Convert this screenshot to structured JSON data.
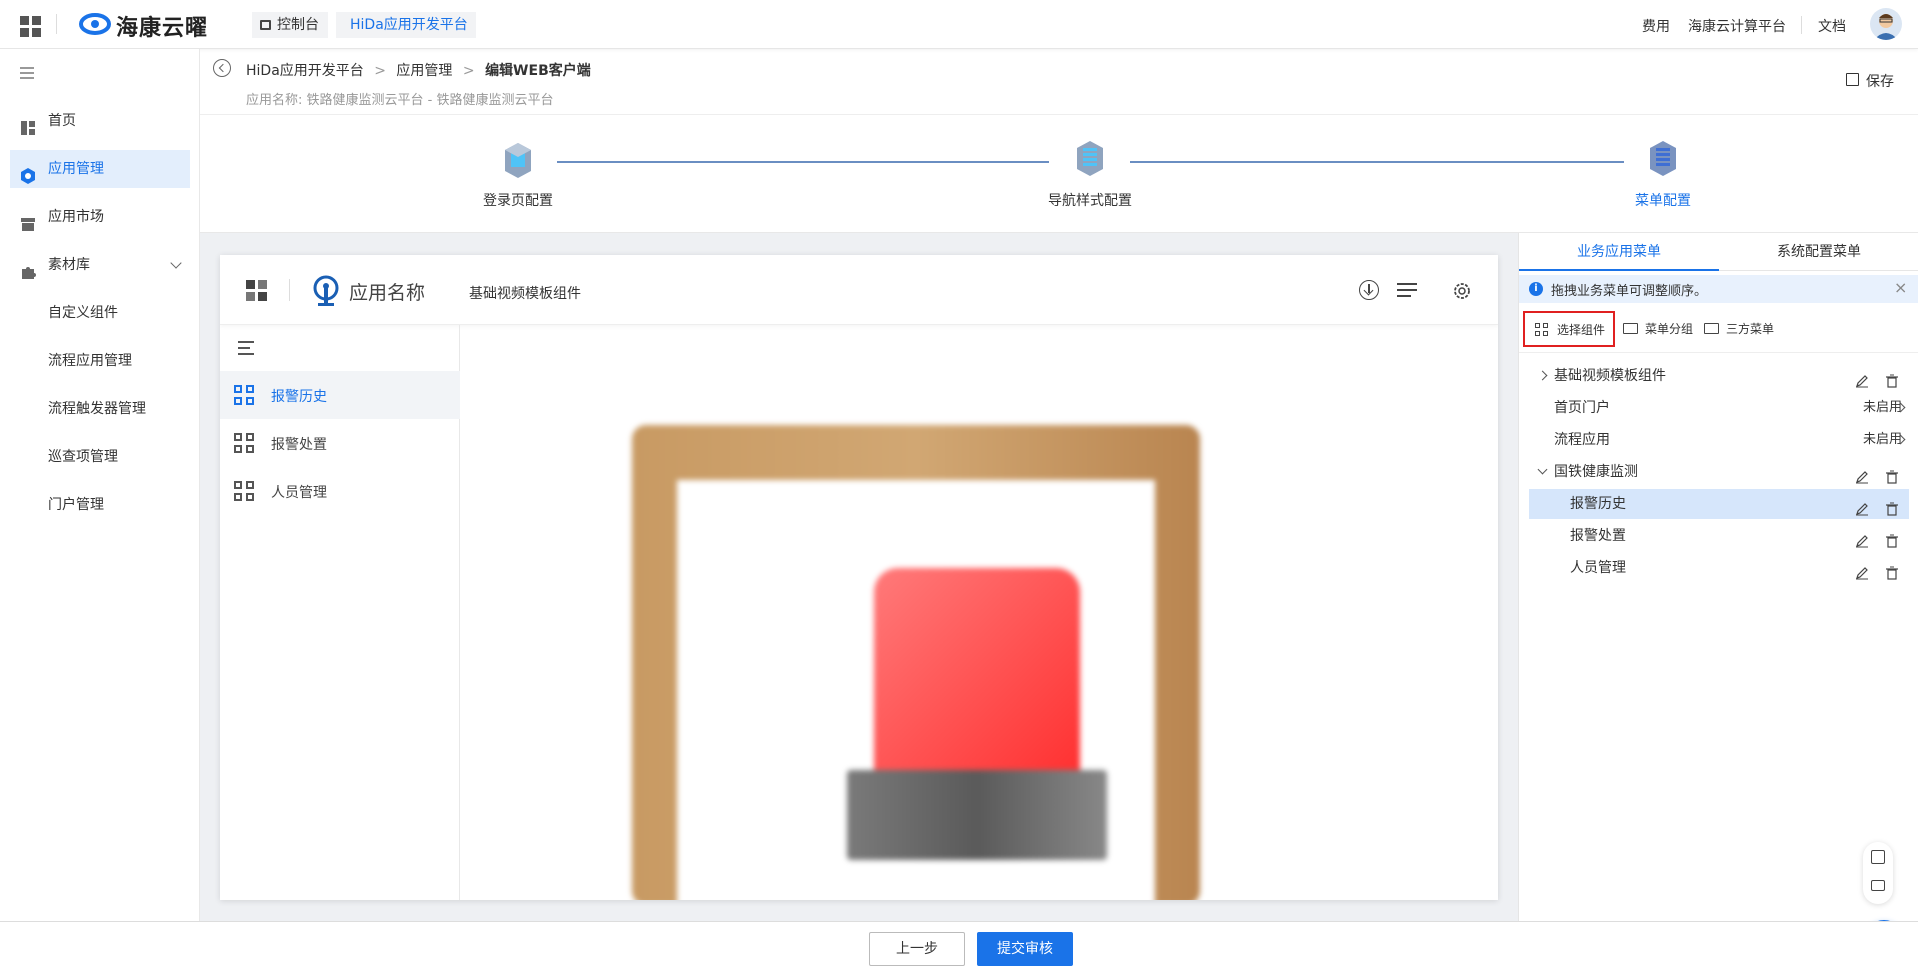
{
  "topbar": {
    "brand": "海康云曜",
    "crumbs": [
      "控制台",
      "HiDa应用开发平台"
    ],
    "right_links": [
      "费用",
      "海康云计算平台",
      "文档"
    ]
  },
  "sidebar": {
    "items": [
      {
        "label": "首页",
        "icon": "dashboard-icon"
      },
      {
        "label": "应用管理",
        "icon": "gear-hex-icon",
        "active": true
      },
      {
        "label": "应用市场",
        "icon": "store-icon"
      },
      {
        "label": "素材库",
        "icon": "puzzle-icon"
      }
    ],
    "sub_items": [
      "自定义组件",
      "流程应用管理",
      "流程触发器管理",
      "巡查项管理",
      "门户管理"
    ]
  },
  "header": {
    "breadcrumb": [
      "HiDa应用开发平台",
      "应用管理",
      "编辑WEB客户端"
    ],
    "app_name_line": "应用名称: 铁路健康监测云平台 - 铁路健康监测云平台",
    "save_label": "保存"
  },
  "steps": {
    "items": [
      "登录页配置",
      "导航样式配置",
      "菜单配置"
    ],
    "active_index": 2
  },
  "preview": {
    "app_title": "应用名称",
    "component_name": "基础视频模板组件",
    "menu": [
      "报警历史",
      "报警处置",
      "人员管理"
    ],
    "active_menu_index": 0
  },
  "right_panel": {
    "tabs": [
      "业务应用菜单",
      "系统配置菜单"
    ],
    "active_tab": 0,
    "notice": "拖拽业务菜单可调整顺序。",
    "toolbar": [
      "选择组件",
      "菜单分组",
      "三方菜单"
    ],
    "tree": [
      {
        "label": "基础视频模板组件",
        "level": 0,
        "expander": "collapsed",
        "status": ""
      },
      {
        "label": "首页门户",
        "level": 0,
        "expander": "none",
        "status": "未启用"
      },
      {
        "label": "流程应用",
        "level": 0,
        "expander": "none",
        "status": "未启用"
      },
      {
        "label": "国铁健康监测",
        "level": 0,
        "expander": "expanded",
        "status": ""
      },
      {
        "label": "报警历史",
        "level": 1,
        "expander": "none",
        "status": "",
        "selected": true
      },
      {
        "label": "报警处置",
        "level": 1,
        "expander": "none",
        "status": ""
      },
      {
        "label": "人员管理",
        "level": 1,
        "expander": "none",
        "status": ""
      }
    ]
  },
  "footer": {
    "prev_label": "上一步",
    "submit_label": "提交审核"
  },
  "colors": {
    "accent": "#1a73e8",
    "highlight_border": "#e02020",
    "selected_row": "#d6e6fb",
    "sidebar_active": "#e3eefc"
  }
}
